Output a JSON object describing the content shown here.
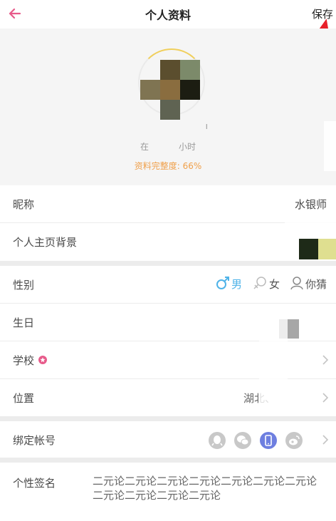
{
  "header": {
    "title": "个人资料",
    "save_label": "保存"
  },
  "profile": {
    "name_partial": "ı",
    "online_text": "在           小时",
    "completion_text": "资料完整度: 66%"
  },
  "fields": {
    "nickname": {
      "label": "昵称",
      "value": "水银师"
    },
    "background": {
      "label": "个人主页背景"
    },
    "gender": {
      "label": "性别",
      "options": [
        "男",
        "女",
        "你猜"
      ],
      "selected": "男"
    },
    "birthday": {
      "label": "生日"
    },
    "school": {
      "label": "学校"
    },
    "location": {
      "label": "位置",
      "value": "湖北、"
    },
    "bind": {
      "label": "绑定帐号",
      "accounts": [
        "qq-icon",
        "wechat-icon",
        "phone-icon",
        "weibo-icon"
      ],
      "bound": "phone-icon"
    },
    "signature": {
      "label": "个性签名",
      "value": "二元论二元论二元论二元论二元论二元论二元论二元论二元论二元论二元论"
    }
  },
  "colors": {
    "accent_pink": "#e75a8a",
    "male_blue": "#4fb3e8",
    "completion_orange": "#f0a04b",
    "bound_blue": "#6e7fe0",
    "annotation_red": "#e8202a"
  }
}
